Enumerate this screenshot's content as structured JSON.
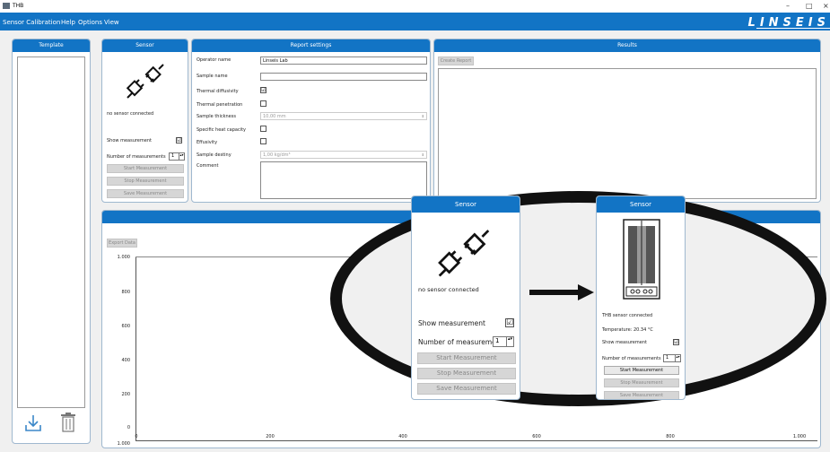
{
  "window": {
    "title": "THB",
    "controls": [
      "–",
      "□",
      "×"
    ]
  },
  "menu": {
    "items": [
      "Sensor Calibration",
      "Help",
      "Options",
      "View"
    ],
    "brand": "LINSEIS"
  },
  "template": {
    "title": "Template"
  },
  "sensor": {
    "title": "Sensor",
    "status": "no sensor connected",
    "show_measurement_label": "Show measurement",
    "show_measurement_checked": "☑",
    "num_measurements_label": "Number of measurements",
    "num_measurements_value": "1",
    "start_label": "Start Measurement",
    "stop_label": "Stop Measurement",
    "save_label": "Save Measurement"
  },
  "report": {
    "title": "Report settings",
    "operator_label": "Operator name",
    "operator_value": "Linseis Lab",
    "sample_name_label": "Sample name",
    "sample_name_value": "",
    "thermal_diffusivity_label": "Thermal diffusivity",
    "thermal_diffusivity_checked": "☑",
    "thermal_penetration_label": "Thermal penetration",
    "sample_thickness_label": "Sample thickness",
    "sample_thickness_value": "10,00 mm",
    "specific_heat_label": "Specific heat capacity",
    "effusivity_label": "Effusivity",
    "sample_density_label": "Sample destiny",
    "sample_density_value": "1,00 kg/dm³",
    "comment_label": "Comment",
    "comment_value": ""
  },
  "results": {
    "title": "Results",
    "create_report_label": "Create Report"
  },
  "plot": {
    "export_label": "Export Data",
    "y_ticks": [
      "1.000",
      "800",
      "600",
      "400",
      "200",
      "0",
      "1.000"
    ],
    "x_ticks": [
      "0",
      "200",
      "400",
      "600",
      "800",
      "1.000"
    ]
  },
  "zoom_left": {
    "title": "Sensor",
    "status": "no sensor connected",
    "show_measurement_label": "Show measurement",
    "show_measurement_checked": "☑",
    "num_measurements_label": "Number of measurements",
    "num_measurements_value": "1",
    "start_label": "Start Measurement",
    "stop_label": "Stop Measurement",
    "save_label": "Save Measurement"
  },
  "zoom_right": {
    "title": "Sensor",
    "status": "THB sensor connected",
    "temperature": "Temperature: 20.34 °C",
    "show_measurement_label": "Show measurement",
    "show_measurement_checked": "☑",
    "num_measurements_label": "Number of measurements",
    "num_measurements_value": "1",
    "start_label": "Start Measurement",
    "stop_label": "Stop Measurement",
    "save_label": "Save Measurement"
  },
  "colors": {
    "accent": "#1274c5",
    "panel_border": "#9fb8cf",
    "oval": "#111111"
  }
}
